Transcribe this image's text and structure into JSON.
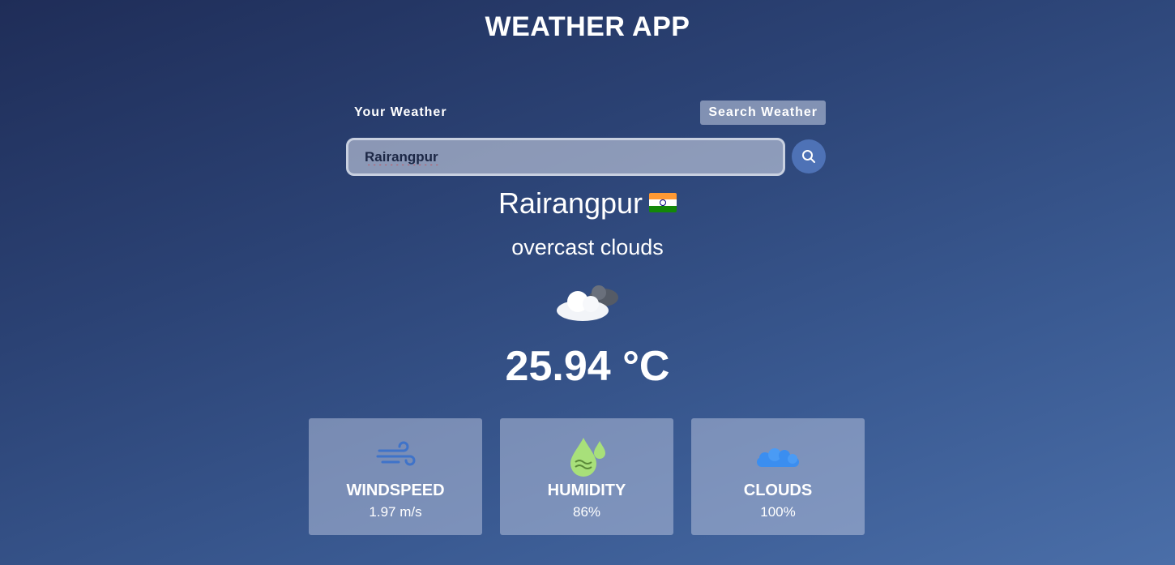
{
  "app": {
    "title": "WEATHER APP"
  },
  "tabs": {
    "your_weather": "Your Weather",
    "search_weather": "Search Weather"
  },
  "search": {
    "value": "Rairangpur",
    "icon": "search-icon"
  },
  "weather": {
    "city": "Rairangpur",
    "flag": "india-flag",
    "description": "overcast clouds",
    "icon": "overcast-clouds-icon",
    "temperature": "25.94 °C"
  },
  "cards": {
    "windspeed": {
      "label": "WINDSPEED",
      "value": "1.97 m/s",
      "icon": "wind-icon",
      "color": "#3f73c9"
    },
    "humidity": {
      "label": "HUMIDITY",
      "value": "86%",
      "icon": "humidity-icon",
      "color": "#a8e07a"
    },
    "clouds": {
      "label": "CLOUDS",
      "value": "100%",
      "icon": "cloud-icon",
      "color": "#3b8ef0"
    }
  }
}
